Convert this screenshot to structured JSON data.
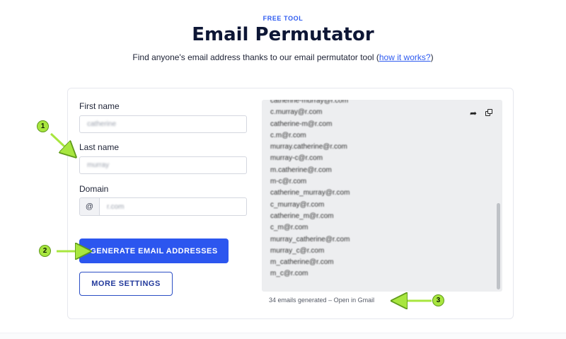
{
  "header": {
    "eyebrow": "FREE TOOL",
    "title": "Email Permutator",
    "subtitle_prefix": "Find anyone's email address thanks to our email permutator tool (",
    "subtitle_link": "how it works?",
    "subtitle_suffix": ")"
  },
  "form": {
    "first_name_label": "First name",
    "first_name_value": "catherine",
    "last_name_label": "Last name",
    "last_name_value": "murray",
    "domain_label": "Domain",
    "domain_prefix": "@",
    "domain_value": "r.com",
    "generate_label": "GENERATE EMAIL ADDRESSES",
    "more_settings_label": "MORE SETTINGS"
  },
  "results": {
    "emails": [
      "catherine-murray@r.com",
      "c.murray@r.com",
      "catherine-m@r.com",
      "c.m@r.com",
      "murray.catherine@r.com",
      "murray-c@r.com",
      "m.catherine@r.com",
      "m-c@r.com",
      "catherine_murray@r.com",
      "c_murray@r.com",
      "catherine_m@r.com",
      "c_m@r.com",
      "murray_catherine@r.com",
      "murray_c@r.com",
      "m_catherine@r.com",
      "m_c@r.com"
    ],
    "status_text": "34 emails generated",
    "status_separator": "–",
    "status_link": "Open in Gmail"
  },
  "icons": {
    "share": "share-arrow-icon",
    "copy": "copy-icon"
  },
  "annotations": {
    "badge_1": "1",
    "badge_2": "2",
    "badge_3": "3",
    "color": "#a8e63f"
  },
  "colors": {
    "primary": "#2c56ef",
    "heading": "#0d1635",
    "accent_text": "#2e5bf0"
  }
}
